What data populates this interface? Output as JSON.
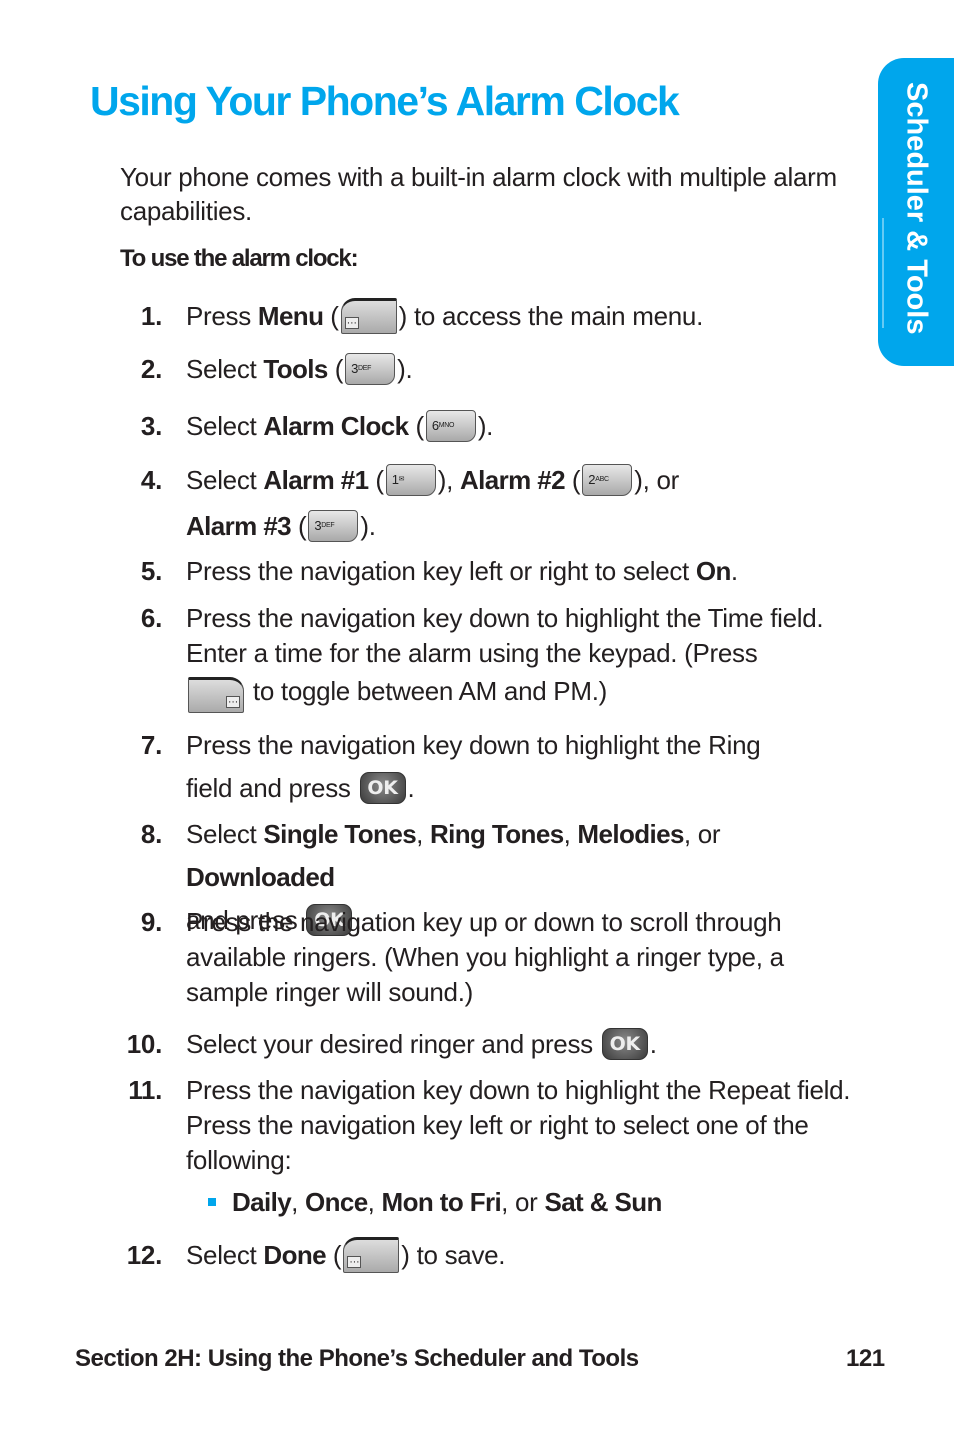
{
  "page": {
    "title": "Using Your Phone’s Alarm Clock",
    "side_tab": "Scheduler & Tools",
    "intro": "Your phone comes with a built-in alarm clock with multiple alarm capabilities.",
    "subhead": "To use the alarm clock:",
    "accent_color": "#00a6ec"
  },
  "keys": {
    "menu": "···",
    "k1": "1",
    "k1_sub": "✉",
    "k2": "2",
    "k2_sub": "ABC",
    "k3": "3",
    "k3_sub": "DEF",
    "k6": "6",
    "k6_sub": "MNO",
    "ok": "OK"
  },
  "steps": [
    {
      "num": "1.",
      "a": "Press ",
      "b": "Menu",
      "c": " (",
      "d": ") to access the main menu."
    },
    {
      "num": "2.",
      "a": "Select ",
      "b": "Tools",
      "c": " (",
      "d": ")."
    },
    {
      "num": "3.",
      "a": "Select ",
      "b": "Alarm Clock",
      "c": " (",
      "d": ")."
    },
    {
      "num": "4.",
      "a": "Select ",
      "b": "Alarm #1",
      "c": " (",
      "d": "), ",
      "e": "Alarm #2",
      "f": " (",
      "g": "), or",
      "h": "Alarm #3",
      "i": " (",
      "j": ")."
    },
    {
      "num": "5.",
      "a": "Press the navigation key left or right to select ",
      "b": "On",
      "c": "."
    },
    {
      "num": "6.",
      "a": "Press the navigation key down to highlight the Time field. Enter a time for the alarm using the keypad. (Press",
      "b": " to toggle between AM and PM.)"
    },
    {
      "num": "7.",
      "a": "Press the navigation key down to highlight the Ring",
      "b": "field and press ",
      "c": "."
    },
    {
      "num": "8.",
      "a": "Select ",
      "b": "Single Tones",
      "c": ", ",
      "d": "Ring Tones",
      "e": ", ",
      "f": "Melodies",
      "g": ", or ",
      "h": "Downloaded",
      "i": "and press ",
      "j": "."
    },
    {
      "num": "9.",
      "a": "Press the navigation key up or down to scroll through available ringers. (When you highlight a ringer type, a sample ringer will sound.)"
    },
    {
      "num": "10.",
      "a": "Select your desired ringer and press ",
      "b": "."
    },
    {
      "num": "11.",
      "a": "Press the navigation key down to highlight the Repeat field. Press the navigation key left or right to select one of the following:"
    },
    {
      "num": "12.",
      "a": "Select ",
      "b": "Done",
      "c": " (",
      "d": ") to save."
    }
  ],
  "repeat_options": {
    "a": "Daily",
    "sep1": ", ",
    "b": "Once",
    "sep2": ", ",
    "c": "Mon to Fri",
    "sep3": ", or ",
    "d": "Sat & Sun"
  },
  "footer": {
    "section": "Section 2H: Using the Phone’s Scheduler and Tools",
    "page": "121"
  }
}
